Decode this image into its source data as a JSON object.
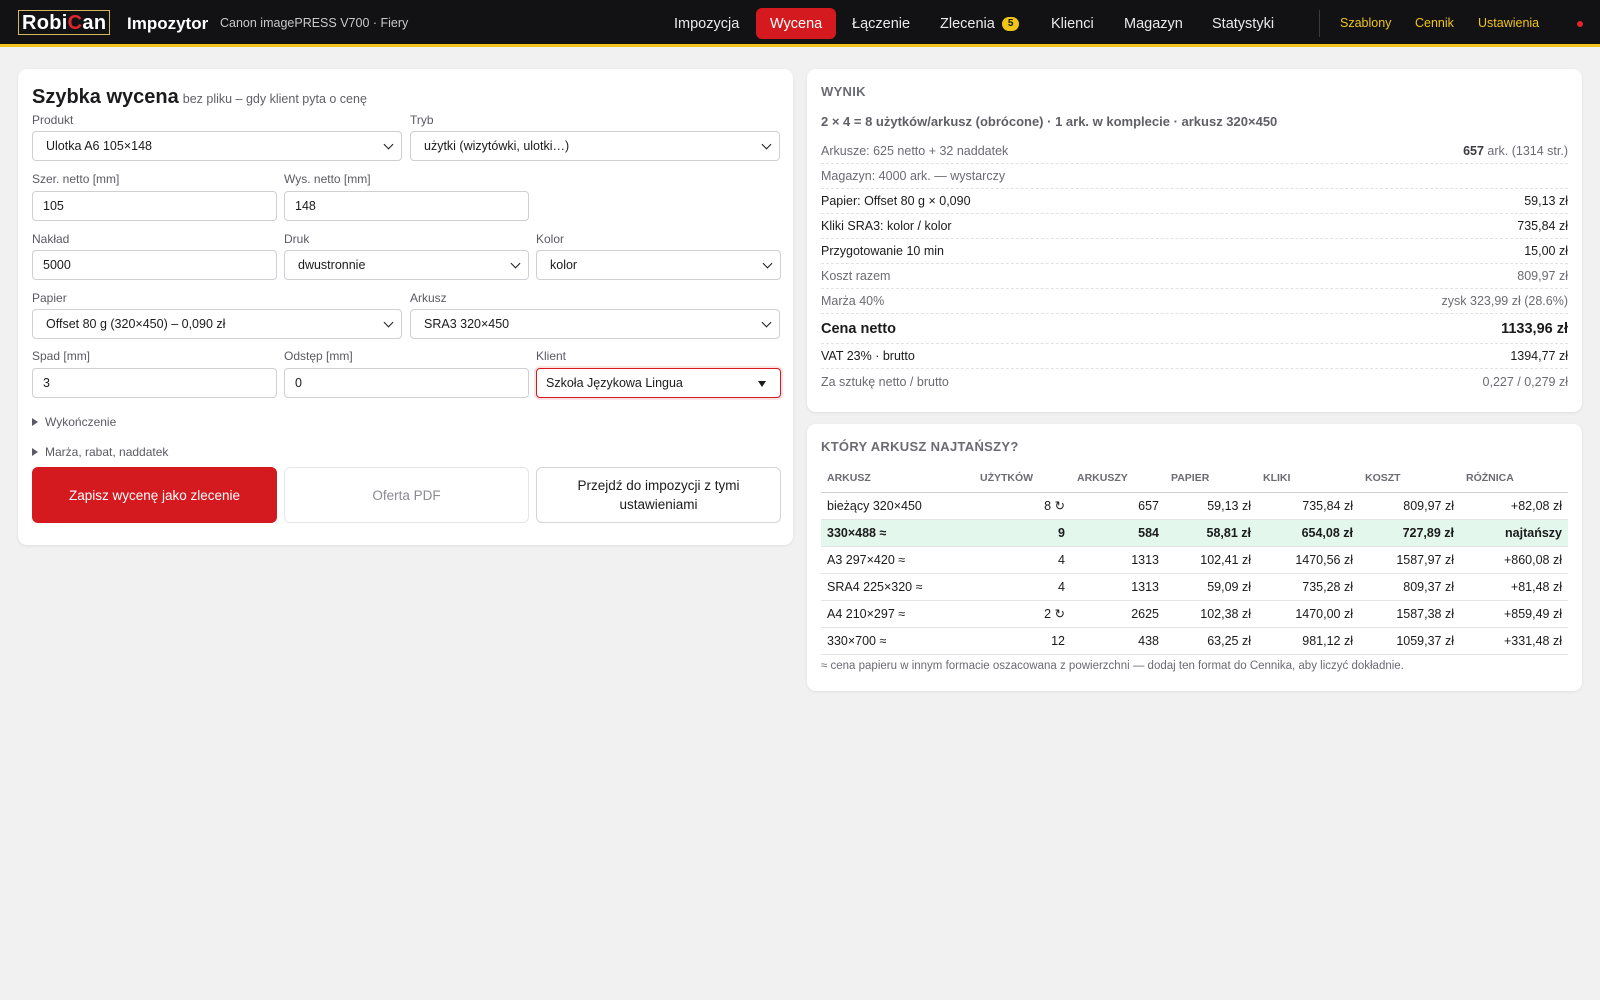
{
  "header": {
    "logo_part1": "Robi",
    "logo_part2": "C",
    "logo_part3": "an",
    "app_title": "Impozytor",
    "printer": "Canon imagePRESS V700 · Fiery",
    "nav": [
      {
        "label": "Impozycja"
      },
      {
        "label": "Wycena",
        "active": true
      },
      {
        "label": "Łączenie"
      },
      {
        "label": "Zlecenia",
        "badge": "5"
      },
      {
        "label": "Klienci"
      },
      {
        "label": "Magazyn"
      },
      {
        "label": "Statystyki"
      }
    ],
    "links": [
      "Szablony",
      "Cennik",
      "Ustawienia"
    ],
    "accent": "#d4191f",
    "highlight": "#f0c419"
  },
  "form": {
    "title": "Szybka wycena",
    "subtitle": "bez pliku – gdy klient pyta o cenę",
    "product": {
      "label": "Produkt",
      "value": "Ulotka A6 105×148"
    },
    "mode": {
      "label": "Tryb",
      "value": "użytki (wizytówki, ulotki…)"
    },
    "width": {
      "label": "Szer. netto [mm]",
      "value": "105"
    },
    "height": {
      "label": "Wys. netto [mm]",
      "value": "148"
    },
    "quantity": {
      "label": "Nakład",
      "value": "5000"
    },
    "print": {
      "label": "Druk",
      "value": "dwustronnie"
    },
    "color": {
      "label": "Kolor",
      "value": "kolor"
    },
    "paper": {
      "label": "Papier",
      "value": "Offset 80 g (320×450) – 0,090 zł"
    },
    "sheet": {
      "label": "Arkusz",
      "value": "SRA3 320×450"
    },
    "bleed": {
      "label": "Spad [mm]",
      "value": "3"
    },
    "gap": {
      "label": "Odstęp [mm]",
      "value": "0"
    },
    "client": {
      "label": "Klient",
      "value": "Szkoła Językowa Lingua"
    },
    "finishing": "Wykończenie",
    "margin_section": "Marża, rabat, naddatek",
    "btn_save": "Zapisz wycenę jako zlecenie",
    "btn_pdf": "Oferta PDF",
    "btn_impose": "Przejdź do impozycji z tymi ustawieniami"
  },
  "result": {
    "heading": "WYNIK",
    "summary": "2 × 4 = 8 użytków/arkusz (obrócone) · 1 ark. w komplecie · arkusz 320×450",
    "sheets_label": "Arkusze: 625 netto + 32 naddatek",
    "sheets_value_bold": "657",
    "sheets_value_rest": " ark. (1314 str.)",
    "stock": "Magazyn: 4000 ark. — wystarczy",
    "paper_label": "Papier: Offset 80 g × 0,090",
    "paper_value": "59,13 zł",
    "clicks_label": "Kliki SRA3: kolor / kolor",
    "clicks_value": "735,84 zł",
    "prep_label": "Przygotowanie 10 min",
    "prep_value": "15,00 zł",
    "cost_label": "Koszt razem",
    "cost_value": "809,97 zł",
    "margin_label": "Marża 40%",
    "margin_value": "zysk 323,99 zł (28.6%)",
    "net_label": "Cena netto",
    "net_value": "1133,96 zł",
    "vat_label": "VAT 23% · brutto",
    "vat_value": "1394,77 zł",
    "unit_label": "Za sztukę netto / brutto",
    "unit_value": "0,227 / 0,279 zł"
  },
  "compare": {
    "heading": "KTÓRY ARKUSZ NAJTAŃSZY?",
    "columns": [
      "ARKUSZ",
      "UŻYTKÓW",
      "ARKUSZY",
      "PAPIER",
      "KLIKI",
      "KOSZT",
      "RÓŻNICA"
    ],
    "rows": [
      [
        "bieżący 320×450",
        "8 ↻",
        "657",
        "59,13 zł",
        "735,84 zł",
        "809,97 zł",
        "+82,08 zł"
      ],
      [
        "330×488 ≈",
        "9",
        "584",
        "58,81 zł",
        "654,08 zł",
        "727,89 zł",
        "najtańszy"
      ],
      [
        "A3 297×420 ≈",
        "4",
        "1313",
        "102,41 zł",
        "1470,56 zł",
        "1587,97 zł",
        "+860,08 zł"
      ],
      [
        "SRA4 225×320 ≈",
        "4",
        "1313",
        "59,09 zł",
        "735,28 zł",
        "809,37 zł",
        "+81,48 zł"
      ],
      [
        "A4 210×297 ≈",
        "2 ↻",
        "2625",
        "102,38 zł",
        "1470,00 zł",
        "1587,38 zł",
        "+859,49 zł"
      ],
      [
        "330×700 ≈",
        "12",
        "438",
        "63,25 zł",
        "981,12 zł",
        "1059,37 zł",
        "+331,48 zł"
      ]
    ],
    "best_row": 1,
    "note": "≈ cena papieru w innym formacie oszacowana z powierzchni — dodaj ten format do Cennika, aby liczyć dokładnie."
  }
}
